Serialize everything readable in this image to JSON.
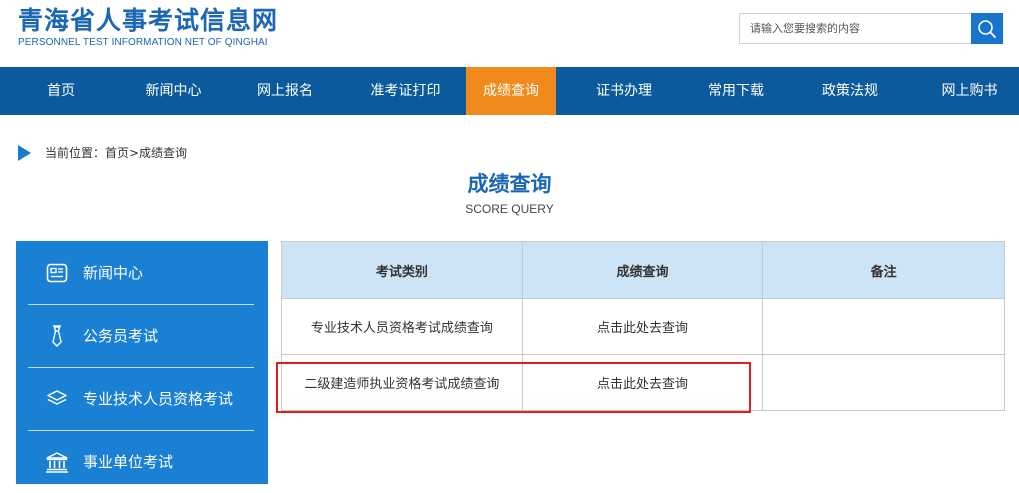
{
  "header": {
    "title": "青海省人事考试信息网",
    "subtitle": "PERSONNEL TEST INFORMATION NET OF QINGHAI",
    "search_placeholder": "请输入您要搜索的内容",
    "search_icon": "search-icon"
  },
  "nav": {
    "items": [
      {
        "label": "首页"
      },
      {
        "label": "新闻中心"
      },
      {
        "label": "网上报名"
      },
      {
        "label": "准考证打印"
      },
      {
        "label": "成绩查询",
        "active": true
      },
      {
        "label": "证书办理"
      },
      {
        "label": "常用下载"
      },
      {
        "label": "政策法规"
      },
      {
        "label": "网上购书"
      }
    ]
  },
  "breadcrumb": {
    "text": "当前位置：首页>成绩查询"
  },
  "page": {
    "title": "成绩查询",
    "subtitle": "SCORE QUERY"
  },
  "sidebar": {
    "items": [
      {
        "label": "新闻中心",
        "icon": "news-icon"
      },
      {
        "label": "公务员考试",
        "icon": "tie-icon"
      },
      {
        "label": "专业技术人员资格考试",
        "icon": "layers-icon"
      },
      {
        "label": "事业单位考试",
        "icon": "institution-icon"
      }
    ]
  },
  "table": {
    "headers": [
      "考试类别",
      "成绩查询",
      "备注"
    ],
    "rows": [
      {
        "category": "专业技术人员资格考试成绩查询",
        "query": "点击此处去查询",
        "note": ""
      },
      {
        "category": "二级建造师执业资格考试成绩查询",
        "query": "点击此处去查询",
        "note": ""
      }
    ]
  },
  "colors": {
    "brand": "#1b67b3",
    "nav_bg": "#0b5b9c",
    "nav_active": "#f08a1c",
    "sidebar_bg": "#1a80d3",
    "table_header_bg": "#cde4f6",
    "highlight": "#e02020"
  }
}
